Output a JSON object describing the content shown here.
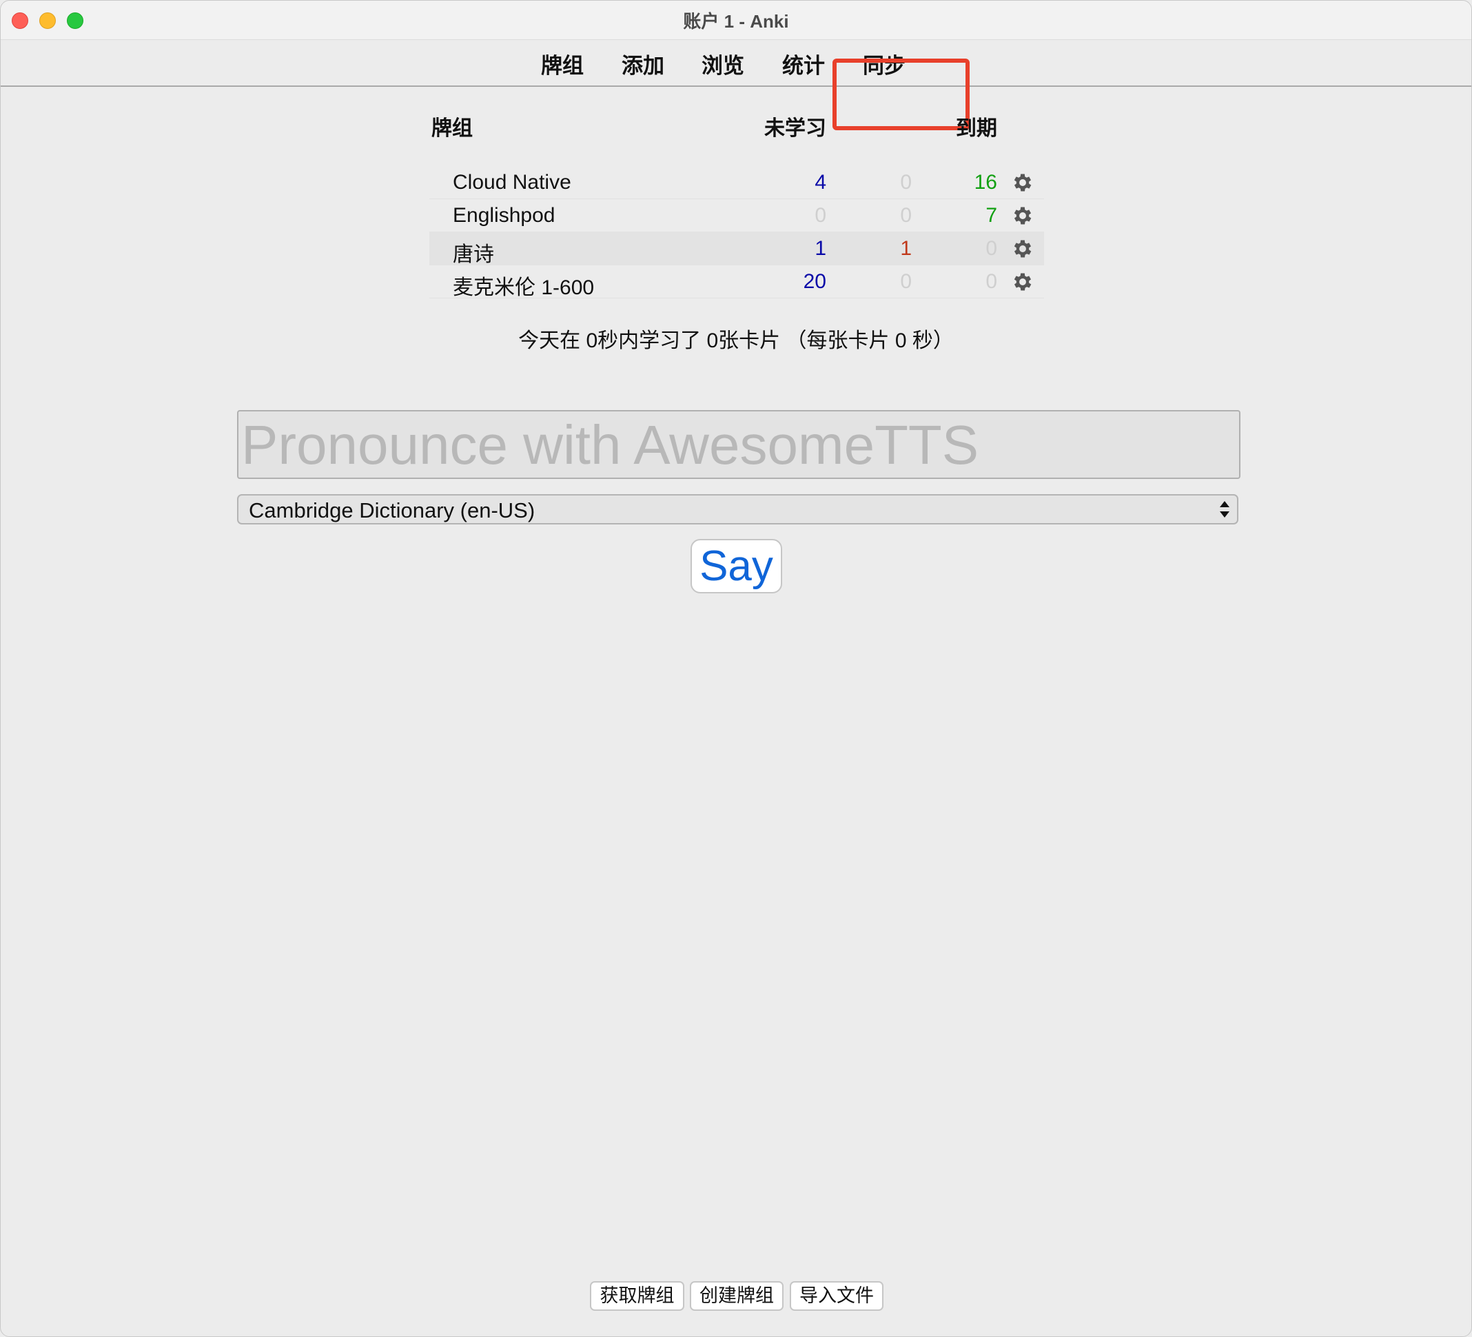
{
  "window": {
    "title": "账户 1 - Anki"
  },
  "toolbar": {
    "decks": "牌组",
    "add": "添加",
    "browse": "浏览",
    "stats": "统计",
    "sync": "同步"
  },
  "deck_table": {
    "headers": {
      "deck": "牌组",
      "new": "未学习",
      "due": "到期"
    },
    "rows": [
      {
        "name": "Cloud Native",
        "new": "4",
        "learn": "0",
        "due": "16"
      },
      {
        "name": "Englishpod",
        "new": "0",
        "learn": "0",
        "due": "7"
      },
      {
        "name": "唐诗",
        "new": "1",
        "learn": "1",
        "due": "0"
      },
      {
        "name": "麦克米伦 1-600",
        "new": "20",
        "learn": "0",
        "due": "0"
      }
    ]
  },
  "study_stats": "今天在 0秒内学习了 0张卡片 （每张卡片 0 秒）",
  "awesometts": {
    "placeholder": "Pronounce with AwesomeTTS",
    "service": "Cambridge Dictionary (en-US)",
    "say_label": "Say"
  },
  "bottom_bar": {
    "get_shared": "获取牌组",
    "create_deck": "创建牌组",
    "import_file": "导入文件"
  },
  "colors": {
    "new": "#0a0aa8",
    "learn": "#c0391b",
    "due": "#12a012",
    "zero": "#cfcfcf",
    "highlight": "#e8402b",
    "say": "#1065d8"
  }
}
